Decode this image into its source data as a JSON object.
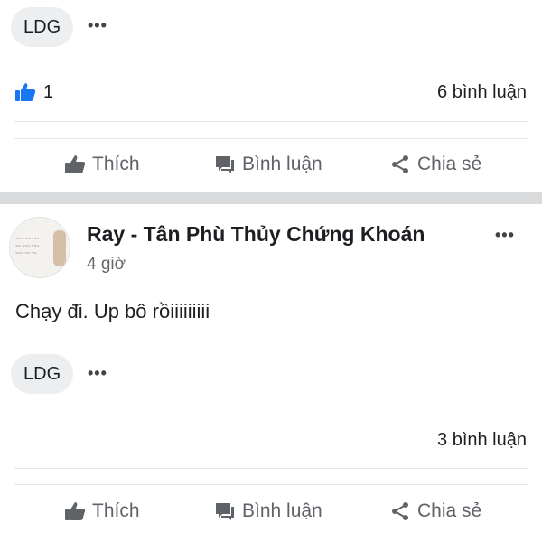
{
  "post_top": {
    "reaction_chip": "LDG",
    "more_menu": "•••",
    "like_count": "1",
    "comment_count": "6 bình luận",
    "actions": {
      "like": "Thích",
      "comment": "Bình luận",
      "share": "Chia sẻ"
    }
  },
  "post_bottom": {
    "author": "Ray - Tân Phù Thủy Chứng Khoán",
    "time": "4 giờ",
    "content": "Chạy đi. Up bô rồiiiiiiiii",
    "more_menu": "•••",
    "reaction_chip": "LDG",
    "reaction_more": "•••",
    "comment_count": "3 bình luận",
    "actions": {
      "like": "Thích",
      "comment": "Bình luận",
      "share": "Chia sẻ"
    }
  },
  "icons": {
    "like_reaction": "thumbs-up-blue-icon",
    "like_action": "thumbs-up-icon",
    "comment_action": "comment-icon",
    "share_action": "share-icon"
  },
  "colors": {
    "like_blue": "#1877f2",
    "action_gray": "#5f6368",
    "separator": "#d9dadc"
  }
}
